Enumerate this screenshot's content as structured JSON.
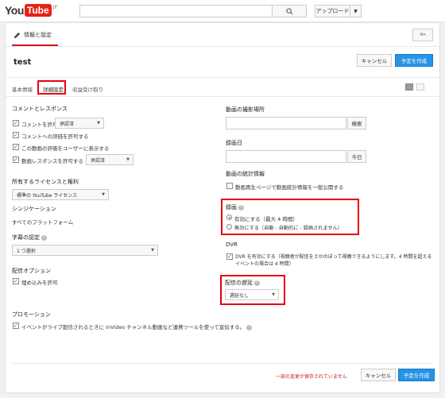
{
  "header": {
    "logo_you": "You",
    "logo_tube": "Tube",
    "logo_region": "JP",
    "search_placeholder": "",
    "upload_label": "アップロード"
  },
  "panel": {
    "tab_info": "情報と設定",
    "back_icon": "back-arrow-icon"
  },
  "event": {
    "title": "test",
    "cancel_label": "キャンセル",
    "create_label": "予定を作成"
  },
  "subtabs": [
    "基本情報",
    "詳細設定",
    "収益受け取り"
  ],
  "left": {
    "comments_heading": "コメントとレスポンス",
    "allow_comments": "コメントを許可",
    "comments_select": "承認済",
    "allow_ratings": "コメントへの評価を許可する",
    "show_ratings": "この動画の評価をユーザーに表示する",
    "allow_responses": "動画レスポンスを許可する",
    "responses_select": "承認済",
    "license_heading": "所有するライセンスと権利",
    "license_select": "標準の YouTube ライセンス",
    "syndication_heading": "シンジケーション",
    "syndication_value": "すべてのプラットフォーム",
    "caption_heading": "字幕の認定",
    "caption_select": "1 つ選択",
    "delivery_heading": "配信オプション",
    "embed_label": "埋め込みを許可",
    "promo_heading": "プロモーション",
    "promo_label": "イベントがライブ配信されるときに inVideo チャンネル動画など連携ツールを使って宣伝する。"
  },
  "right": {
    "location_heading": "動画の撮影場所",
    "search_btn": "検索",
    "date_heading": "録画日",
    "today_btn": "今日",
    "stats_heading": "動画の統計情報",
    "stats_label": "動画再生ページで動画統計情報を一般公開する",
    "archive_heading": "録画",
    "archive_on": "有効にする（最大 4 時間）",
    "archive_off": "無効にする（自動 - 自動的に - 録画されません）",
    "dvr_heading": "DVR",
    "dvr_label": "DVR を有効にする（視聴者が配信をさかのぼって視聴できるようにします。4 時間を超えるイベントの場合は 4 時間）",
    "latency_heading": "配信の遅延",
    "latency_select": "遅延なし"
  },
  "footer": {
    "warning": "一部の変更が保存されていません",
    "cancel_label": "キャンセル",
    "create_label": "予定を作成"
  }
}
